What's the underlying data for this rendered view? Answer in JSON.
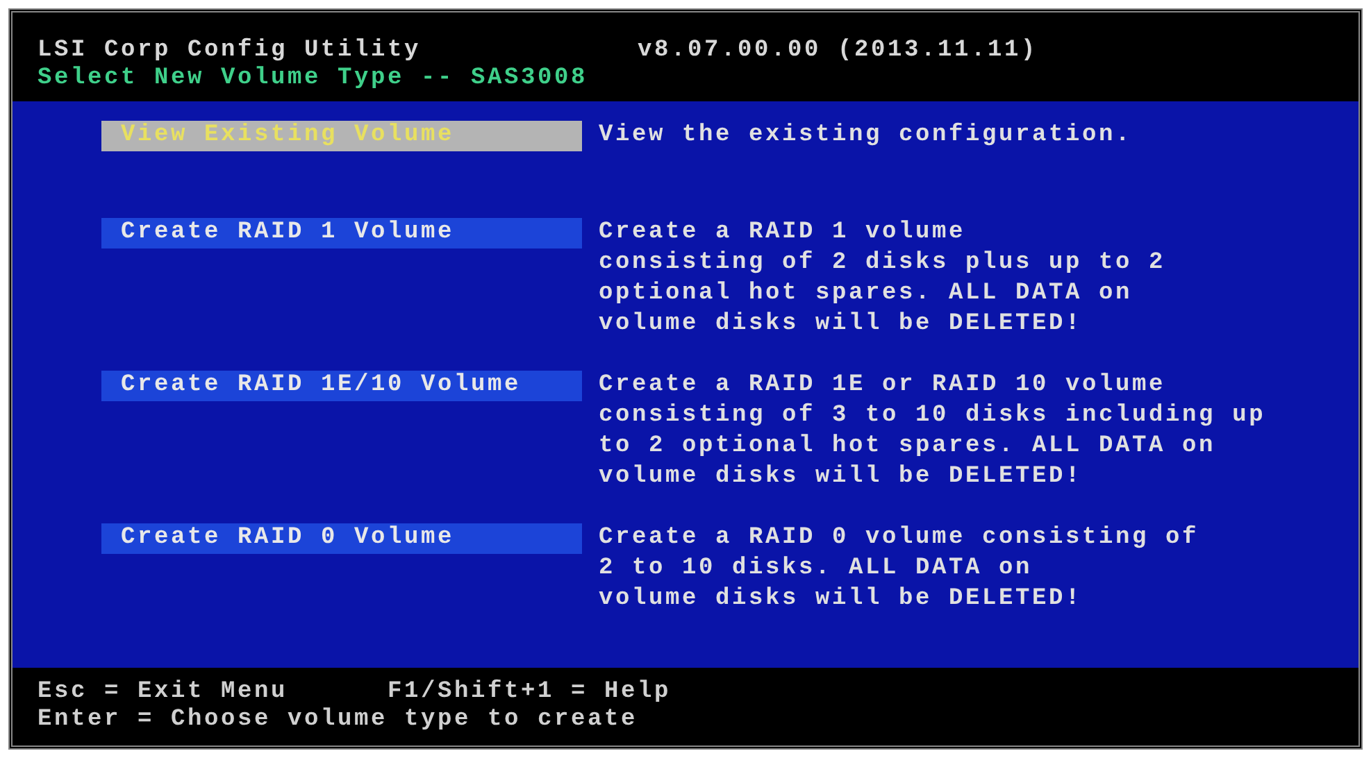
{
  "header": {
    "title": "LSI Corp Config Utility",
    "version": "v8.07.00.00 (2013.11.11)",
    "subtitle": "Select New Volume Type -- SAS3008"
  },
  "menu": [
    {
      "label": "View Existing Volume",
      "selected": true,
      "description": [
        "View the existing configuration."
      ]
    },
    {
      "label": "Create RAID 1 Volume",
      "selected": false,
      "description": [
        "Create a RAID 1 volume",
        "consisting of 2 disks plus up to 2",
        "optional hot spares. ALL DATA on",
        "volume disks will be DELETED!"
      ]
    },
    {
      "label": "Create RAID 1E/10 Volume",
      "selected": false,
      "description": [
        "Create a RAID 1E or RAID 10 volume",
        "consisting of 3 to 10 disks including up",
        "to 2 optional hot spares. ALL DATA on",
        "volume disks will be DELETED!"
      ]
    },
    {
      "label": "Create RAID 0 Volume",
      "selected": false,
      "description": [
        "Create a RAID 0 volume consisting of",
        "2 to 10 disks. ALL DATA on",
        "volume disks will be DELETED!"
      ]
    }
  ],
  "footer": {
    "lines": [
      [
        "Esc = Exit Menu",
        "F1/Shift+1 = Help"
      ],
      [
        "Enter = Choose volume type to create"
      ]
    ]
  }
}
